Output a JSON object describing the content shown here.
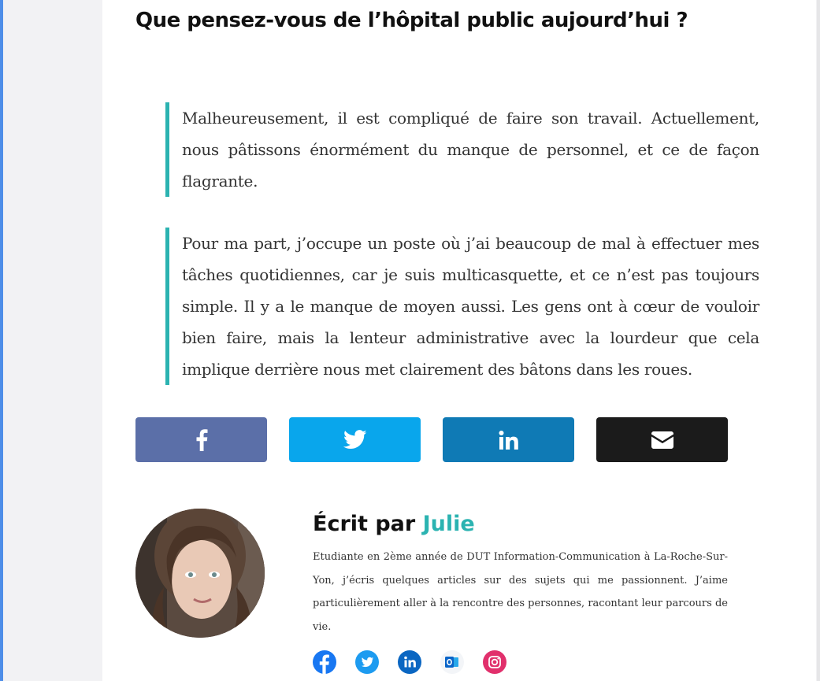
{
  "article": {
    "title": "Que pensez-vous de l’hôpital public aujourd’hui ?",
    "quotes": [
      "Malheureusement, il est compliqué de faire son travail. Actuellement, nous pâtissons énormément du manque de personnel, et ce de façon flagrante.",
      "Pour ma part, j’occupe un poste où j’ai beaucoup de mal à effectuer mes tâches quotidiennes, car je suis multicasquette, et ce n’est pas toujours simple. Il y a le manque de moyen aussi. Les gens ont à cœur de vouloir bien faire, mais la lenteur administrative avec la lourdeur que cela implique derrière nous met clairement des bâtons dans les roues."
    ]
  },
  "share": {
    "buttons": [
      {
        "icon": "facebook-icon",
        "color": "#5b6fa8"
      },
      {
        "icon": "twitter-icon",
        "color": "#09a6ec"
      },
      {
        "icon": "linkedin-icon",
        "color": "#0f7ab5"
      },
      {
        "icon": "email-icon",
        "color": "#1b1b1b"
      }
    ]
  },
  "author": {
    "prefix": "Écrit par",
    "name": "Julie",
    "bio": "Etudiante en 2ème année de DUT Information-Communication à La-Roche-Sur-Yon, j’écris quelques articles sur des sujets qui me passionnent. J’aime particulièrement aller à la rencontre des personnes, racontant leur parcours de vie.",
    "socials": [
      {
        "icon": "facebook-icon",
        "color": "#1877f2"
      },
      {
        "icon": "twitter-icon",
        "color": "#1d9bf0"
      },
      {
        "icon": "linkedin-icon",
        "color": "#0a66c2"
      },
      {
        "icon": "outlook-icon",
        "color": "#0a64c8"
      },
      {
        "icon": "instagram-icon",
        "color": "#e1306c"
      }
    ]
  },
  "colors": {
    "accent": "#2bb3b1"
  }
}
